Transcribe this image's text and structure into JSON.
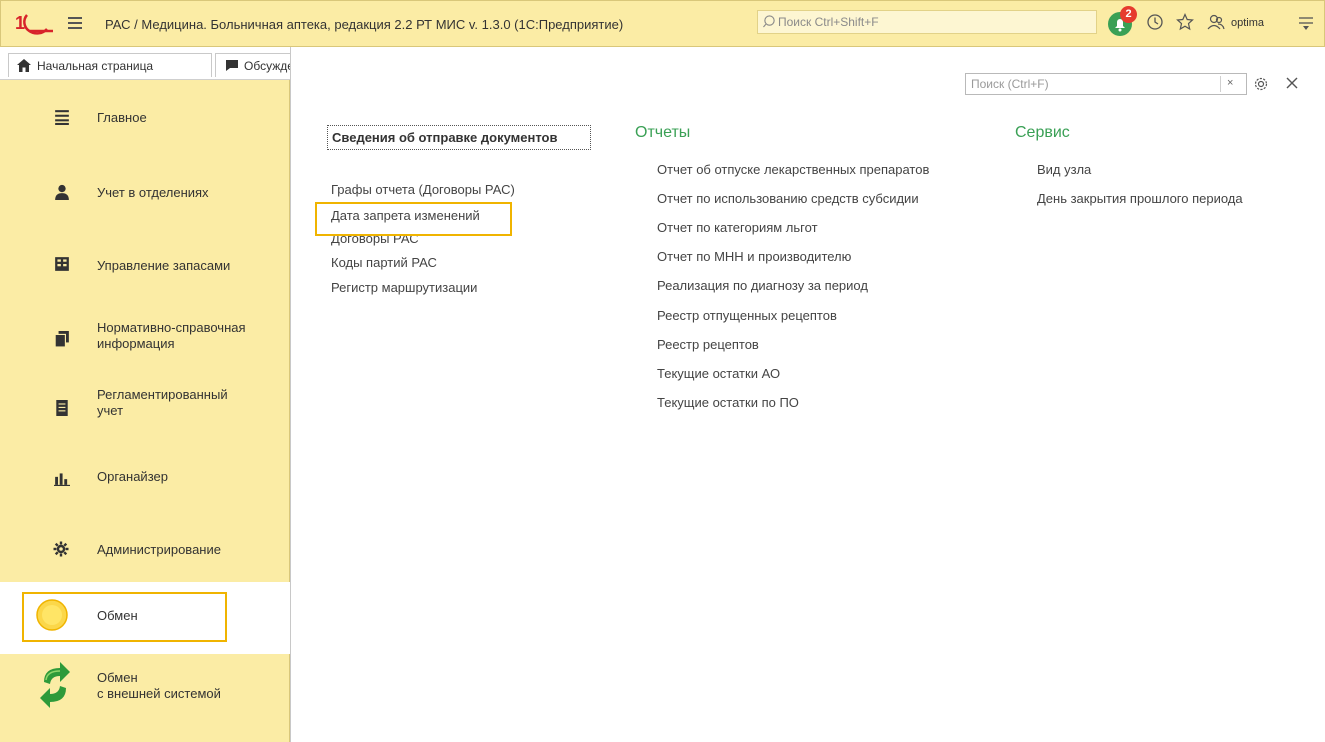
{
  "titlebar": {
    "logo": "1С",
    "menu_icon": "hamburger-icon",
    "title": "РАС / Медицина. Больничная аптека, редакция 2.2 РТ МИС v. 1.3.0  (1С:Предприятие)",
    "search_placeholder": "Поиск Ctrl+Shift+F",
    "notifications_count": "2",
    "username": "optima"
  },
  "tabs": [
    {
      "label": "Начальная страница",
      "icon": "home-icon"
    },
    {
      "label": "Обсуждения",
      "icon": "chat-icon"
    }
  ],
  "sidebar": {
    "items": [
      {
        "label": "Главное",
        "icon": "list-icon"
      },
      {
        "label": "Учет в отделениях",
        "icon": "person-icon"
      },
      {
        "label": "Управление запасами",
        "icon": "warehouse-icon"
      },
      {
        "label": "Нормативно-справочная\nинформация",
        "icon": "cards-icon"
      },
      {
        "label": "Регламентированный\nучет",
        "icon": "document-icon"
      },
      {
        "label": "Органайзер",
        "icon": "chart-icon"
      },
      {
        "label": "Администрирование",
        "icon": "gear-icon"
      },
      {
        "label": "Обмен",
        "icon": "circle-icon",
        "selected": true
      },
      {
        "label": "Обмен\nс внешней системой",
        "icon": "sync-icon"
      }
    ]
  },
  "panel": {
    "search_placeholder": "Поиск (Ctrl+F)",
    "clear_label": "×",
    "docs_heading": "Сведения об отправке документов",
    "docs_links": [
      "Графы отчета (Договоры РАС)",
      "Дата запрета изменений",
      "Договоры РАС",
      "Коды партий РАС",
      "Регистр маршрутизации"
    ],
    "reports_heading": "Отчеты",
    "reports_links": [
      "Отчет об отпуске лекарственных препаратов",
      "Отчет по использованию средств субсидии",
      "Отчет по категориям льгот",
      "Отчет по МНН и производителю",
      "Реализация по диагнозу за период",
      "Реестр отпущенных рецептов",
      "Реестр рецептов",
      "Текущие остатки АО",
      "Текущие остатки по ПО"
    ],
    "service_heading": "Сервис",
    "service_links": [
      "Вид узла",
      "День закрытия прошлого периода"
    ]
  },
  "colors": {
    "sidebar_bg": "#fbeca5",
    "accent_green": "#3aa055",
    "highlight": "#f0b400"
  }
}
